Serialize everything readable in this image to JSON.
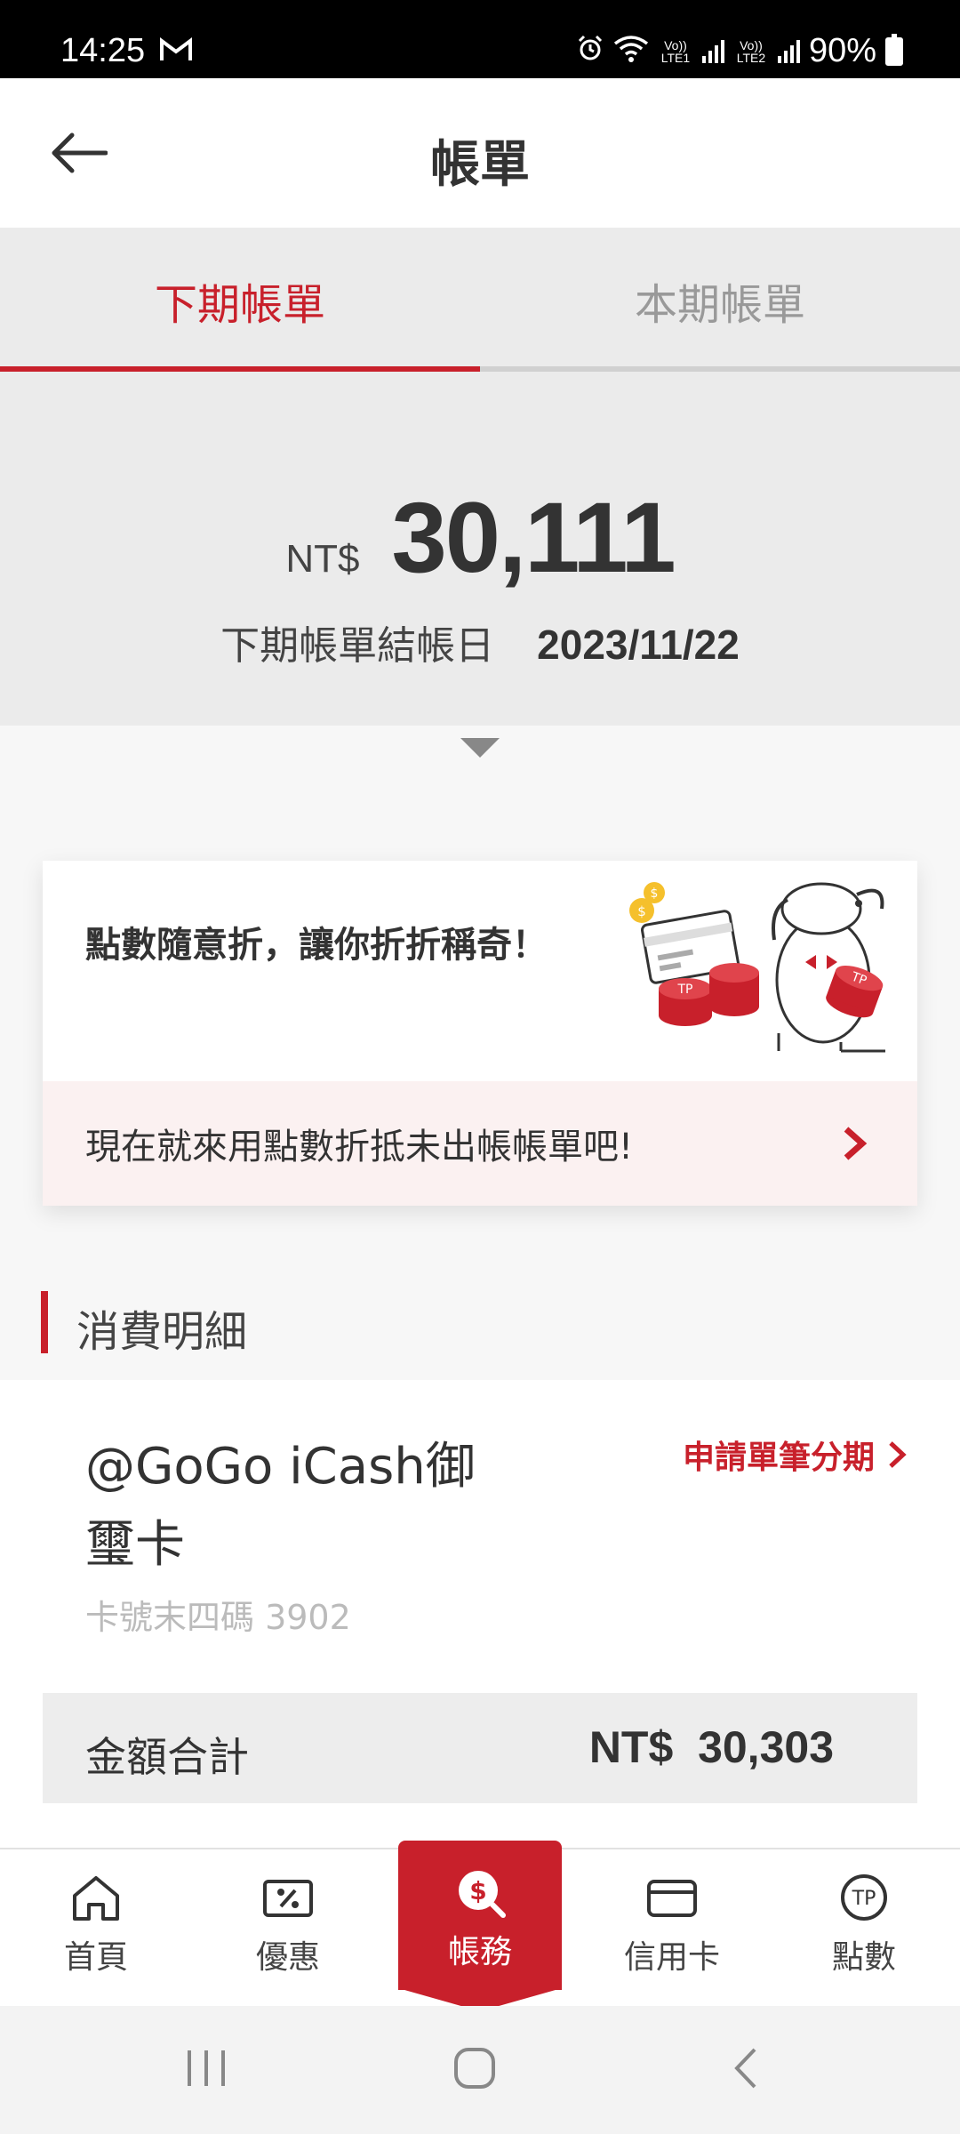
{
  "status_bar": {
    "time": "14:25",
    "mail_icon": "gmail-icon",
    "net1": "Vo)) LTE1",
    "net2": "Vo)) LTE2",
    "battery": "90%"
  },
  "header": {
    "title": "帳單",
    "back_icon": "arrow-left-icon"
  },
  "tabs": [
    {
      "label": "下期帳單",
      "active": true
    },
    {
      "label": "本期帳單",
      "active": false
    }
  ],
  "summary": {
    "currency": "NT$",
    "amount": "30,111",
    "closing_label": "下期帳單結帳日",
    "closing_date": "2023/11/22"
  },
  "promo": {
    "title": "點數隨意折，讓你折折稱奇！",
    "footer_text": "現在就來用點數折抵未出帳帳單吧!"
  },
  "section": {
    "title": "消費明細"
  },
  "card": {
    "name": "@GoGo iCash御璽卡",
    "number_label": "卡號末四碼 3902",
    "installment_link": "申請單筆分期",
    "total_label": "金額合計",
    "total_value": "NT$  30,303"
  },
  "bottom_nav": [
    {
      "label": "首頁",
      "icon": "home-icon",
      "active": false
    },
    {
      "label": "優惠",
      "icon": "discount-icon",
      "active": false
    },
    {
      "label": "帳務",
      "icon": "billing-icon",
      "active": true
    },
    {
      "label": "信用卡",
      "icon": "credit-card-icon",
      "active": false
    },
    {
      "label": "點數",
      "icon": "points-icon",
      "active": false
    }
  ],
  "colors": {
    "accent": "#c8202b",
    "background": "#f7f7f7"
  }
}
